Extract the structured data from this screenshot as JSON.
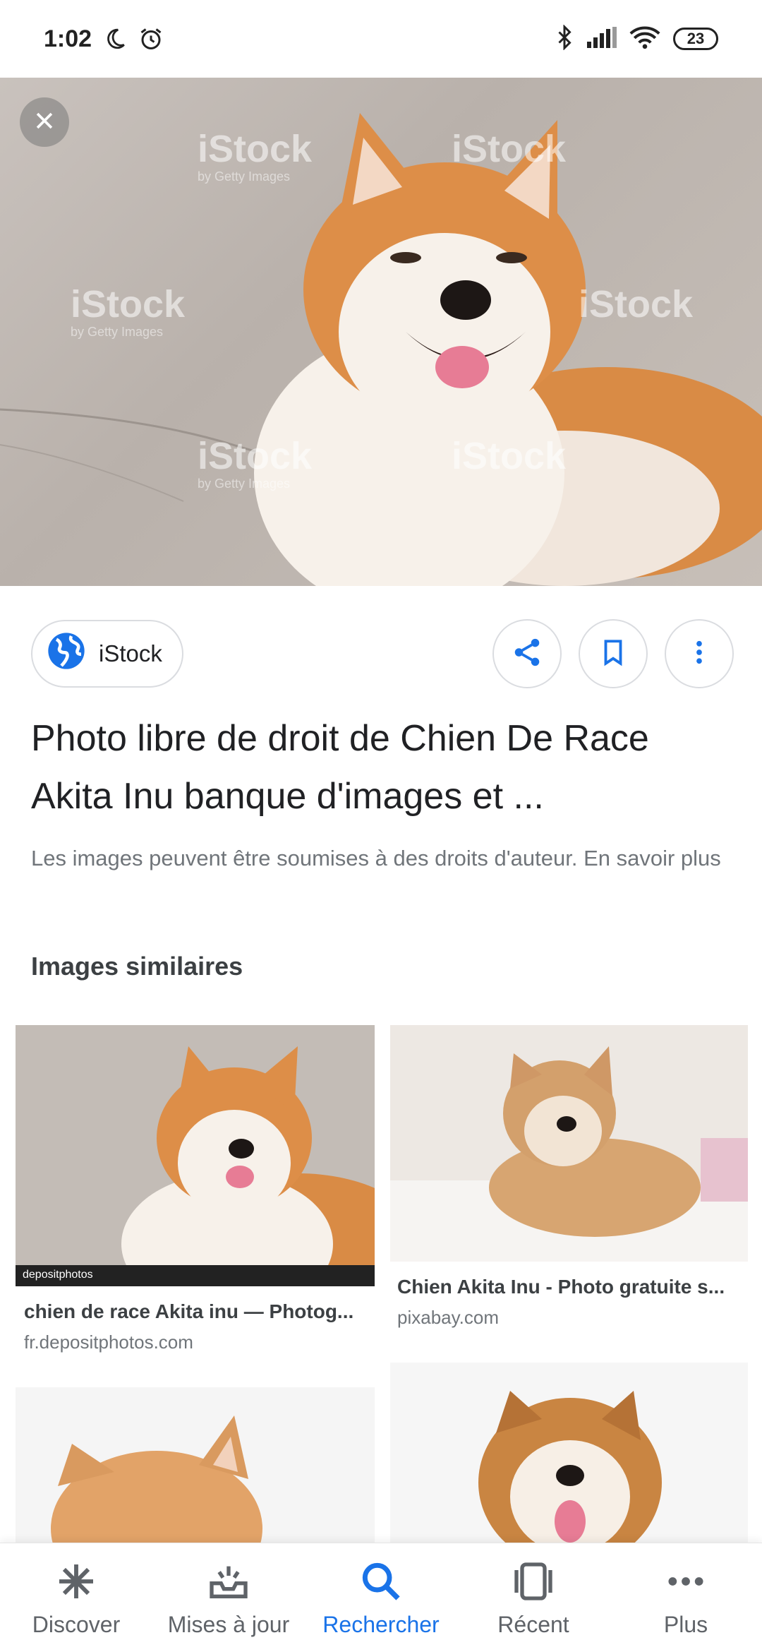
{
  "status_bar": {
    "time": "1:02",
    "battery": "23",
    "icons": [
      "moon-icon",
      "alarm-icon",
      "bluetooth-icon",
      "signal-icon",
      "wifi-icon",
      "battery-icon"
    ]
  },
  "hero": {
    "watermark_text": "iStock",
    "watermark_sub": "by Getty Images",
    "close_icon": "close-icon"
  },
  "source": {
    "name": "iStock",
    "icon": "globe-icon"
  },
  "actions": {
    "share_icon": "share-icon",
    "bookmark_icon": "bookmark-icon",
    "more_icon": "more-vert-icon"
  },
  "result": {
    "title": "Photo libre de droit de Chien De Race Akita Inu banque d'images et ...",
    "copyright_notice": "Les images peuvent être soumises à des droits d'auteur. En savoir plus"
  },
  "similar": {
    "heading": "Images similaires",
    "items": [
      {
        "title": "chien de race Akita inu — Photog...",
        "source": "fr.depositphotos.com",
        "watermark": "depositphotos"
      },
      {
        "title": "Chien Akita Inu - Photo gratuite s...",
        "source": "pixabay.com"
      },
      {
        "title": "",
        "source": ""
      },
      {
        "title": "",
        "source": ""
      }
    ]
  },
  "bottom_nav": {
    "items": [
      {
        "label": "Discover",
        "icon": "asterisk-icon"
      },
      {
        "label": "Mises à jour",
        "icon": "updates-inbox-icon"
      },
      {
        "label": "Rechercher",
        "icon": "search-icon",
        "active": true
      },
      {
        "label": "Récent",
        "icon": "recent-cards-icon"
      },
      {
        "label": "Plus",
        "icon": "more-horiz-icon"
      }
    ]
  },
  "colors": {
    "accent": "#1a73e8",
    "text_primary": "#202124",
    "text_secondary": "#70757a",
    "border": "#dadce0"
  }
}
